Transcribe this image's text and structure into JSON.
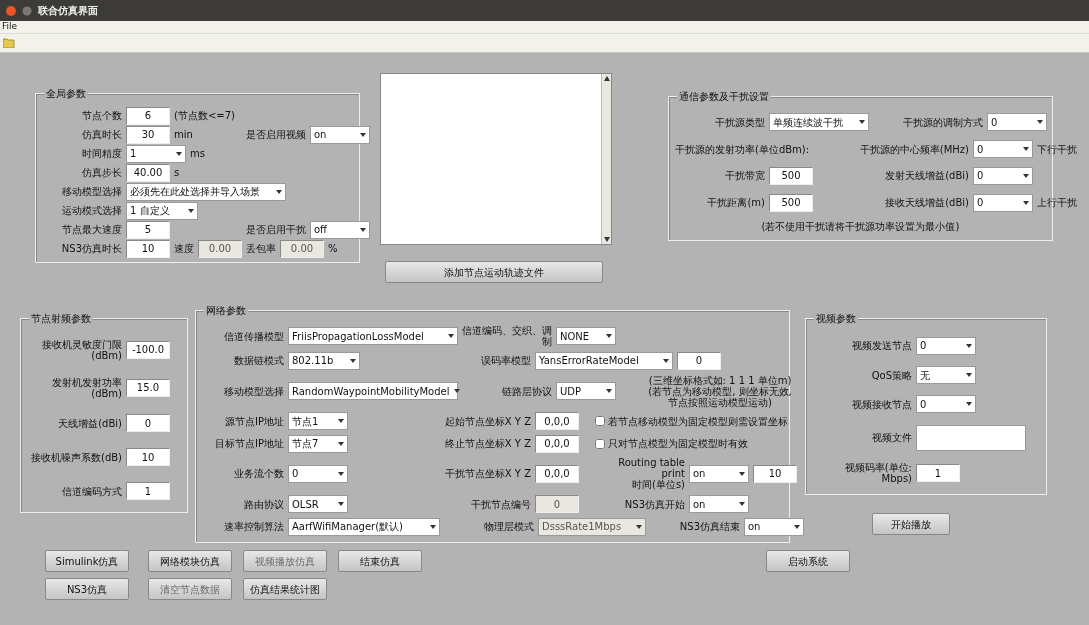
{
  "window": {
    "title": "联合仿真界面"
  },
  "menu": [
    {
      "label": "File"
    }
  ],
  "panels": [
    {
      "title": "全局参数",
      "rows": [
        [
          [
            {
              "kind": "label",
              "text": "节点个数"
            },
            {
              "kind": "input",
              "value": "6"
            },
            {
              "kind": "unit",
              "text": "(节点数<=7)"
            }
          ]
        ],
        [
          [
            {
              "kind": "label",
              "text": "仿真时长"
            },
            {
              "kind": "input",
              "value": "30"
            },
            {
              "kind": "unit",
              "text": "min"
            }
          ],
          [
            {
              "kind": "label",
              "text": "是否启用视频"
            },
            {
              "kind": "select",
              "value": "on"
            }
          ]
        ],
        [
          [
            {
              "kind": "label",
              "text": "时间精度"
            },
            {
              "kind": "select",
              "value": "1"
            },
            {
              "kind": "unit",
              "text": "ms"
            }
          ]
        ],
        [
          [
            {
              "kind": "label",
              "text": "仿真步长"
            },
            {
              "kind": "input",
              "value": "40.00"
            },
            {
              "kind": "unit",
              "text": "s"
            }
          ]
        ],
        [
          [
            {
              "kind": "label",
              "text": "移动模型选择"
            },
            {
              "kind": "select",
              "value": "必须先在此处选择并导入场景"
            }
          ]
        ],
        [
          [
            {
              "kind": "label",
              "text": "运动模式选择"
            },
            {
              "kind": "select",
              "value": "1 自定义"
            }
          ]
        ],
        [
          [
            {
              "kind": "label",
              "text": "节点最大速度"
            },
            {
              "kind": "input",
              "value": "5"
            }
          ],
          [
            {
              "kind": "label",
              "text": "是否启用干扰"
            },
            {
              "kind": "select",
              "value": "off"
            }
          ]
        ],
        [
          [
            {
              "kind": "label",
              "text": "NS3仿真时长"
            },
            {
              "kind": "input",
              "value": "10"
            },
            {
              "kind": "label",
              "text": "速度"
            },
            {
              "kind": "input",
              "value": "0.00",
              "disabled": true
            },
            {
              "kind": "label",
              "text": "丢包率"
            },
            {
              "kind": "input",
              "value": "0.00",
              "disabled": true
            },
            {
              "kind": "unit",
              "text": "%"
            }
          ]
        ]
      ]
    },
    {
      "title": "通信参数及干扰设置",
      "rows": [
        [
          [
            {
              "kind": "label",
              "text": "干扰源类型"
            },
            {
              "kind": "select",
              "value": "单频连续波干扰"
            }
          ],
          [
            {
              "kind": "label",
              "text": "干扰源的调制方式"
            },
            {
              "kind": "select",
              "value": "0"
            }
          ]
        ],
        [
          [
            {
              "kind": "unit",
              "text": "干扰源的发射功率(单位dBm):"
            }
          ],
          [
            {
              "kind": "label",
              "text": "干扰源的中心频率(MHz)"
            },
            {
              "kind": "select",
              "value": "0"
            }
          ],
          [
            {
              "kind": "unit",
              "text": "下行干扰"
            }
          ]
        ],
        [
          [
            {
              "kind": "label",
              "text": "干扰带宽"
            },
            {
              "kind": "input",
              "value": "500"
            }
          ],
          [
            {
              "kind": "label",
              "text": "发射天线增益(dBi)"
            },
            {
              "kind": "select",
              "value": "0"
            }
          ]
        ],
        [
          [
            {
              "kind": "label",
              "text": "干扰距离(m)"
            },
            {
              "kind": "input",
              "value": "500"
            }
          ],
          [
            {
              "kind": "label",
              "text": "接收天线增益(dBi)"
            },
            {
              "kind": "select",
              "value": "0"
            }
          ],
          [
            {
              "kind": "unit",
              "text": "上行干扰"
            }
          ]
        ],
        [
          [
            {
              "kind": "note",
              "text": "(若不使用干扰请将干扰源功率设置为最小值)"
            }
          ]
        ]
      ]
    },
    {
      "title": "节点射频参数",
      "rows": [
        [
          [
            {
              "kind": "label",
              "text": "接收机灵敏度门限(dBm)"
            },
            {
              "kind": "input",
              "value": "-100.0"
            }
          ]
        ],
        [
          [
            {
              "kind": "label",
              "text": "发射机发射功率(dBm)"
            },
            {
              "kind": "input",
              "value": "15.0"
            }
          ]
        ],
        [
          [
            {
              "kind": "label",
              "text": "天线增益(dBi)"
            },
            {
              "kind": "input",
              "value": "0"
            }
          ]
        ],
        [
          [
            {
              "kind": "label",
              "text": "接收机噪声系数(dB)"
            },
            {
              "kind": "input",
              "value": "10"
            }
          ]
        ],
        [
          [
            {
              "kind": "label",
              "text": "信道编码方式"
            },
            {
              "kind": "input",
              "value": "1"
            }
          ]
        ]
      ]
    },
    {
      "title": "网络参数",
      "rows": [
        [
          [
            {
              "kind": "label",
              "text": "信道传播模型"
            },
            {
              "kind": "select",
              "value": "FriisPropagationLossModel"
            }
          ],
          [
            {
              "kind": "label",
              "text": "信道编码、交织、调制"
            },
            {
              "kind": "select",
              "value": "NONE"
            }
          ]
        ],
        [
          [
            {
              "kind": "label",
              "text": "数据链模式"
            },
            {
              "kind": "select",
              "value": "802.11b"
            }
          ],
          [
            {
              "kind": "label",
              "text": "误码率模型"
            },
            {
              "kind": "select",
              "value": "YansErrorRateModel"
            },
            {
              "kind": "input",
              "value": "0"
            }
          ]
        ],
        [
          [
            {
              "kind": "label",
              "text": "移动模型选择"
            },
            {
              "kind": "select",
              "value": "RandomWaypointMobilityModel"
            }
          ],
          [
            {
              "kind": "label",
              "text": "链路层协议"
            },
            {
              "kind": "select",
              "value": "UDP"
            }
          ],
          [
            {
              "kind": "note",
              "text": "(三维坐标格式如: 1 1 1 单位m)\n(若节点为移动模型, 则坐标无效,\n节点按照运动模型运动)"
            }
          ]
        ],
        [
          [
            {
              "kind": "label",
              "text": "源节点IP地址"
            },
            {
              "kind": "select",
              "value": "节点1"
            }
          ],
          [
            {
              "kind": "label",
              "text": "起始节点坐标X Y Z"
            },
            {
              "kind": "input",
              "value": "0,0,0"
            }
          ],
          [
            {
              "kind": "checkbox",
              "text": "若节点移动模型为固定模型则需设置坐标",
              "checked": false
            }
          ]
        ],
        [
          [
            {
              "kind": "label",
              "text": "目标节点IP地址"
            },
            {
              "kind": "select",
              "value": "节点7"
            }
          ],
          [
            {
              "kind": "label",
              "text": "终止节点坐标X Y Z"
            },
            {
              "kind": "input",
              "value": "0,0,0"
            }
          ],
          [
            {
              "kind": "checkbox",
              "text": "只对节点模型为固定模型时有效",
              "checked": false
            }
          ]
        ],
        [
          [
            {
              "kind": "label",
              "text": "业务流个数"
            },
            {
              "kind": "select",
              "value": "0"
            }
          ],
          [
            {
              "kind": "label",
              "text": "干扰节点坐标X Y Z"
            },
            {
              "kind": "input",
              "value": "0,0,0"
            }
          ],
          [
            {
              "kind": "label",
              "text": "Routing table print\n时间(单位s)"
            },
            {
              "kind": "select",
              "value": "on"
            },
            {
              "kind": "input",
              "value": "10"
            }
          ]
        ],
        [
          [
            {
              "kind": "label",
              "text": "路由协议"
            },
            {
              "kind": "select",
              "value": "OLSR"
            }
          ],
          [
            {
              "kind": "label",
              "text": "干扰节点编号"
            },
            {
              "kind": "input",
              "value": "0",
              "disabled": true
            }
          ],
          [
            {
              "kind": "label",
              "text": "NS3仿真开始"
            },
            {
              "kind": "select",
              "value": "on"
            }
          ]
        ],
        [
          [
            {
              "kind": "label",
              "text": "速率控制算法"
            },
            {
              "kind": "select",
              "value": "AarfWifiManager(默认)"
            }
          ],
          [
            {
              "kind": "label",
              "text": "物理层模式"
            },
            {
              "kind": "select",
              "value": "DsssRate1Mbps",
              "disabled": true
            }
          ],
          [
            {
              "kind": "label",
              "text": "NS3仿真结束"
            },
            {
              "kind": "select",
              "value": "on"
            }
          ]
        ]
      ]
    },
    {
      "title": "视频参数",
      "rows": [
        [
          [
            {
              "kind": "label",
              "text": "视频发送节点"
            },
            {
              "kind": "select",
              "value": "0"
            }
          ]
        ],
        [
          [
            {
              "kind": "label",
              "text": "QoS策略"
            },
            {
              "kind": "select",
              "value": "无"
            }
          ]
        ],
        [
          [
            {
              "kind": "label",
              "text": "视频接收节点"
            },
            {
              "kind": "select",
              "value": "0"
            }
          ]
        ],
        [
          [
            {
              "kind": "label",
              "text": "视频文件"
            },
            {
              "kind": "textbox"
            }
          ]
        ],
        [
          [
            {
              "kind": "label",
              "text": "视频码率(单位: Mbps)"
            },
            {
              "kind": "input",
              "value": "1"
            }
          ]
        ]
      ]
    }
  ],
  "load_button": {
    "label": "添加节点运动轨迹文件"
  },
  "play_button": {
    "label": "开始播放"
  },
  "buttons": [
    {
      "label": "Simulink仿真",
      "disabled": false
    },
    {
      "label": "网络模块仿真",
      "disabled": false
    },
    {
      "label": "视频播放仿真",
      "disabled": true
    },
    {
      "label": "结束仿真",
      "disabled": false
    },
    {
      "label": "启动系统",
      "disabled": false
    },
    {
      "label": "NS3仿真",
      "disabled": false
    },
    {
      "label": "清空节点数据",
      "disabled": true
    },
    {
      "label": "仿真结果统计图",
      "disabled": false
    }
  ]
}
